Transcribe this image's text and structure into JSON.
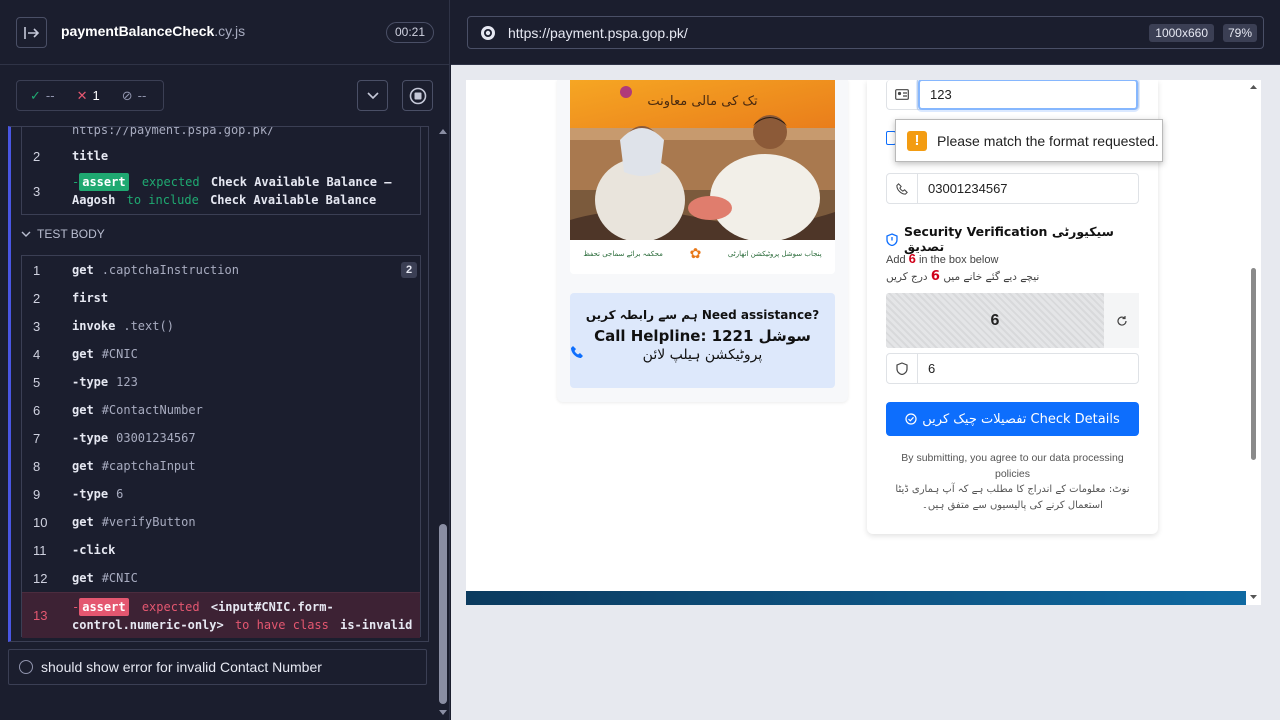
{
  "spec": {
    "name": "paymentBalanceCheck",
    "ext": ".cy.js",
    "timer": "00:21"
  },
  "stats": {
    "passed": "--",
    "failed": "1",
    "pending": "--"
  },
  "before_block": [
    {
      "n": "",
      "cmd": "https://payment.pspa.gop.pk/",
      "msg": ""
    },
    {
      "n": "2",
      "cmd": "title",
      "msg": ""
    },
    {
      "n": "3",
      "assert": "assert",
      "text1": "expected",
      "text2": "Check Available Balance –",
      "line2a": "Aagosh",
      "line2b": "to include",
      "line2c": "Check Available Balance"
    }
  ],
  "section_label": "TEST BODY",
  "commands": [
    {
      "n": "1",
      "cmd": "get",
      "msg": ".captchaInstruction",
      "badge": "2"
    },
    {
      "n": "2",
      "cmd": "first",
      "msg": ""
    },
    {
      "n": "3",
      "cmd": "invoke",
      "msg": ".text()"
    },
    {
      "n": "4",
      "cmd": "get",
      "msg": "#CNIC"
    },
    {
      "n": "5",
      "cmd": "-type",
      "msg": "123"
    },
    {
      "n": "6",
      "cmd": "get",
      "msg": "#ContactNumber"
    },
    {
      "n": "7",
      "cmd": "-type",
      "msg": "03001234567"
    },
    {
      "n": "8",
      "cmd": "get",
      "msg": "#captchaInput"
    },
    {
      "n": "9",
      "cmd": "-type",
      "msg": "6"
    },
    {
      "n": "10",
      "cmd": "get",
      "msg": "#verifyButton"
    },
    {
      "n": "11",
      "cmd": "-click",
      "msg": ""
    },
    {
      "n": "12",
      "cmd": "get",
      "msg": "#CNIC"
    }
  ],
  "failed_command": {
    "n": "13",
    "assert": "assert",
    "expected": "expected",
    "subject1": "<input#CNIC.form-",
    "subject2": "control.numeric-only>",
    "to_have": "to have class",
    "cls": "is-invalid"
  },
  "next_test": "should show error for invalid Contact Number",
  "aut": {
    "url": "https://payment.pspa.gop.pk/",
    "viewport": "1000x660",
    "scale": "79%"
  },
  "poster": {
    "urdu_title": "تک کی مالی معاونت",
    "logos": [
      "محکمہ برائے سماجی تحفظ",
      "پنجاب سوشل پروٹیکشن اتھارٹی"
    ]
  },
  "help": {
    "line1": "ہم سے رابطہ کریں Need assistance?",
    "line2": "Call Helpline: 1221 سوشل",
    "line3": "پروٹیکشن ہیلپ لائن"
  },
  "form": {
    "cnic_value": "123",
    "contact_value": "03001234567",
    "security_title": "Security Verification سیکیورٹی تصدیق",
    "add_prefix": "Add",
    "add_num": "6",
    "add_suffix": "in the box below",
    "urdu_instr_a": "نیچے دیے گئے خانے میں",
    "urdu_instr_num": "6",
    "urdu_instr_b": "درج کریں",
    "captcha_value": "6",
    "captcha_input": "6",
    "button": "تفصیلات چیک کریں Check Details",
    "disclaimer1": "By submitting, you agree to our data processing policies",
    "disclaimer2": "نوٹ: معلومات کے اندراج کا مطلب ہے کہ آپ ہماری ڈیٹا",
    "disclaimer3": "استعمال کرنے کی پالیسیوں سے متفق ہیں۔"
  },
  "tooltip": "Please match the format requested.",
  "colors": {
    "accent": "#4956e3",
    "pass": "#1fa971",
    "fail": "#e45770",
    "primary": "#0d6efd",
    "warning": "#f39c12"
  }
}
